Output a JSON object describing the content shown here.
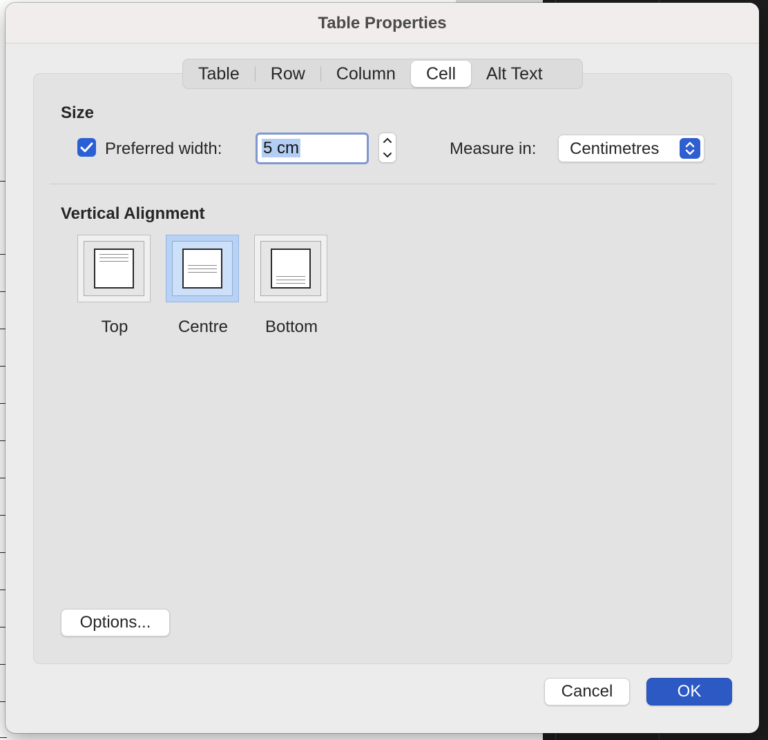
{
  "dialog": {
    "title": "Table Properties",
    "tabs": [
      {
        "label": "Table",
        "selected": false
      },
      {
        "label": "Row",
        "selected": false
      },
      {
        "label": "Column",
        "selected": false
      },
      {
        "label": "Cell",
        "selected": true
      },
      {
        "label": "Alt Text",
        "selected": false
      }
    ],
    "size": {
      "heading": "Size",
      "preferred_width_checked": true,
      "preferred_width_label": "Preferred width:",
      "preferred_width_value": "5 cm",
      "measure_in_label": "Measure in:",
      "measure_in_value": "Centimetres"
    },
    "vertical_alignment": {
      "heading": "Vertical Alignment",
      "options": [
        {
          "label": "Top",
          "selected": false
        },
        {
          "label": "Centre",
          "selected": true
        },
        {
          "label": "Bottom",
          "selected": false
        }
      ]
    },
    "options_button": "Options...",
    "cancel_button": "Cancel",
    "ok_button": "OK"
  },
  "colors": {
    "accent": "#2d59c4",
    "selected_alignment": "#b8d2f5",
    "dialog_bg": "#ececec"
  },
  "icons": [
    "checkmark-icon",
    "stepper-up-icon",
    "stepper-down-icon",
    "popup-arrows-icon",
    "align-top-icon",
    "align-centre-icon",
    "align-bottom-icon"
  ]
}
